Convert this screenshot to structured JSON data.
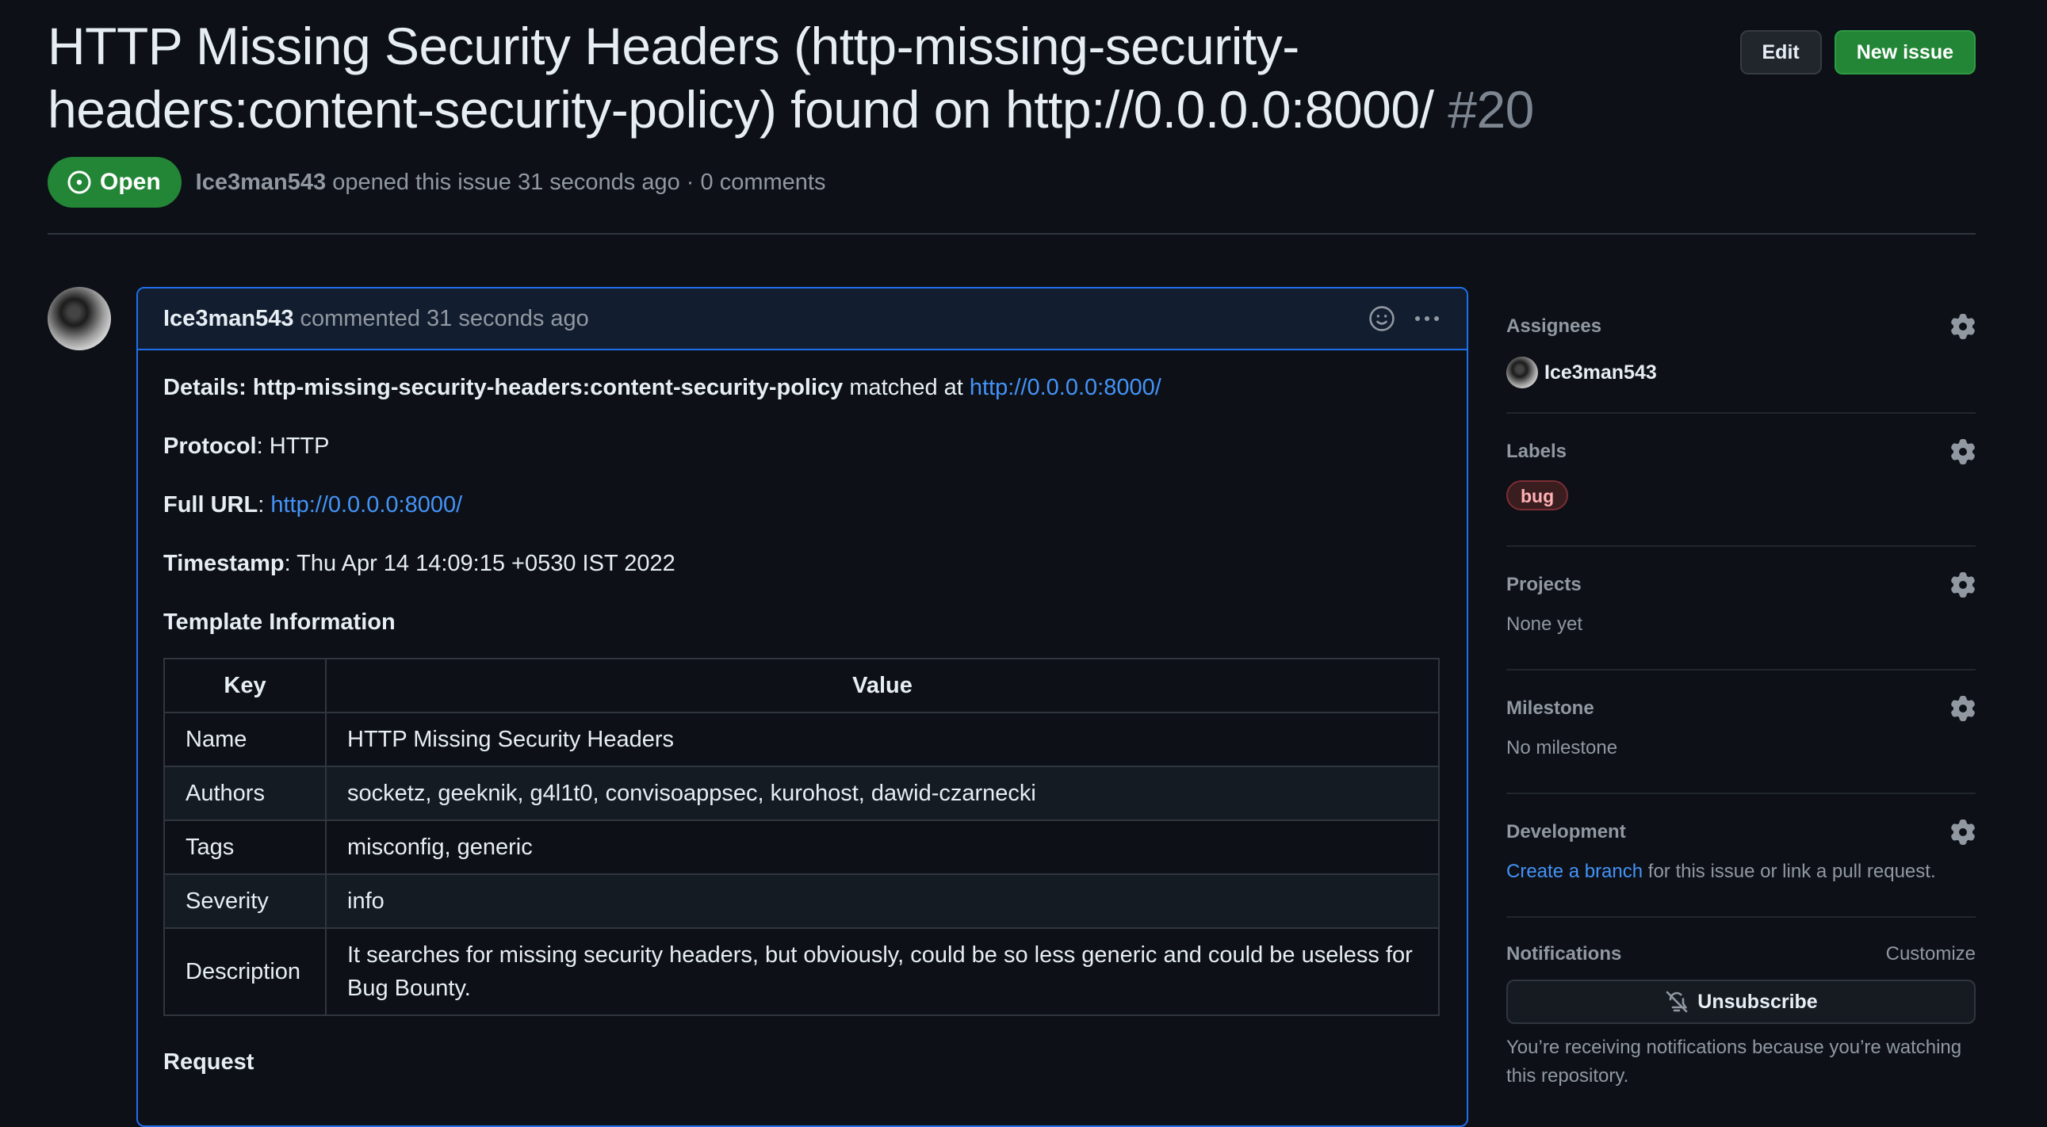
{
  "issue": {
    "title": "HTTP Missing Security Headers (http-missing-security-headers:content-security-policy) found on http://0.0.0.0:8000/",
    "number": "#20",
    "state": "Open",
    "author": "Ice3man543",
    "opened_text": "opened this issue 31 seconds ago · 0 comments"
  },
  "header_buttons": {
    "edit": "Edit",
    "new_issue": "New issue"
  },
  "comment": {
    "author": "Ice3man543",
    "meta": "commented 31 seconds ago",
    "details_label": "Details",
    "details_id": "http-missing-security-headers:content-security-policy",
    "details_matched": "matched at",
    "details_url": "http://0.0.0.0:8000/",
    "protocol_label": "Protocol",
    "protocol_value": "HTTP",
    "fullurl_label": "Full URL",
    "fullurl_value": "http://0.0.0.0:8000/",
    "timestamp_label": "Timestamp",
    "timestamp_value": "Thu Apr 14 14:09:15 +0530 IST 2022",
    "template_title": "Template Information",
    "table_headers": [
      "Key",
      "Value"
    ],
    "table_rows": [
      [
        "Name",
        "HTTP Missing Security Headers"
      ],
      [
        "Authors",
        "socketz, geeknik, g4l1t0, convisoappsec, kurohost, dawid-czarnecki"
      ],
      [
        "Tags",
        "misconfig, generic"
      ],
      [
        "Severity",
        "info"
      ],
      [
        "Description",
        "It searches for missing security headers, but obviously, could be so less generic and could be useless for Bug Bounty."
      ]
    ],
    "request_title": "Request"
  },
  "sidebar": {
    "assignees_label": "Assignees",
    "assignee": "Ice3man543",
    "labels_label": "Labels",
    "label_bug": "bug",
    "projects_label": "Projects",
    "projects_value": "None yet",
    "milestone_label": "Milestone",
    "milestone_value": "No milestone",
    "development_label": "Development",
    "development_link": "Create a branch",
    "development_text": "for this issue or link a pull request.",
    "notifications_label": "Notifications",
    "customize": "Customize",
    "unsubscribe": "Unsubscribe",
    "notify_reason": "You’re receiving notifications because you’re watching this repository."
  },
  "colors": {
    "accent": "#1f6feb",
    "open": "#238636",
    "link": "#4493f8"
  },
  "icons": [
    "issue-opened-icon",
    "smiley-icon",
    "kebab-icon",
    "gear-icon",
    "bell-slash-icon"
  ]
}
